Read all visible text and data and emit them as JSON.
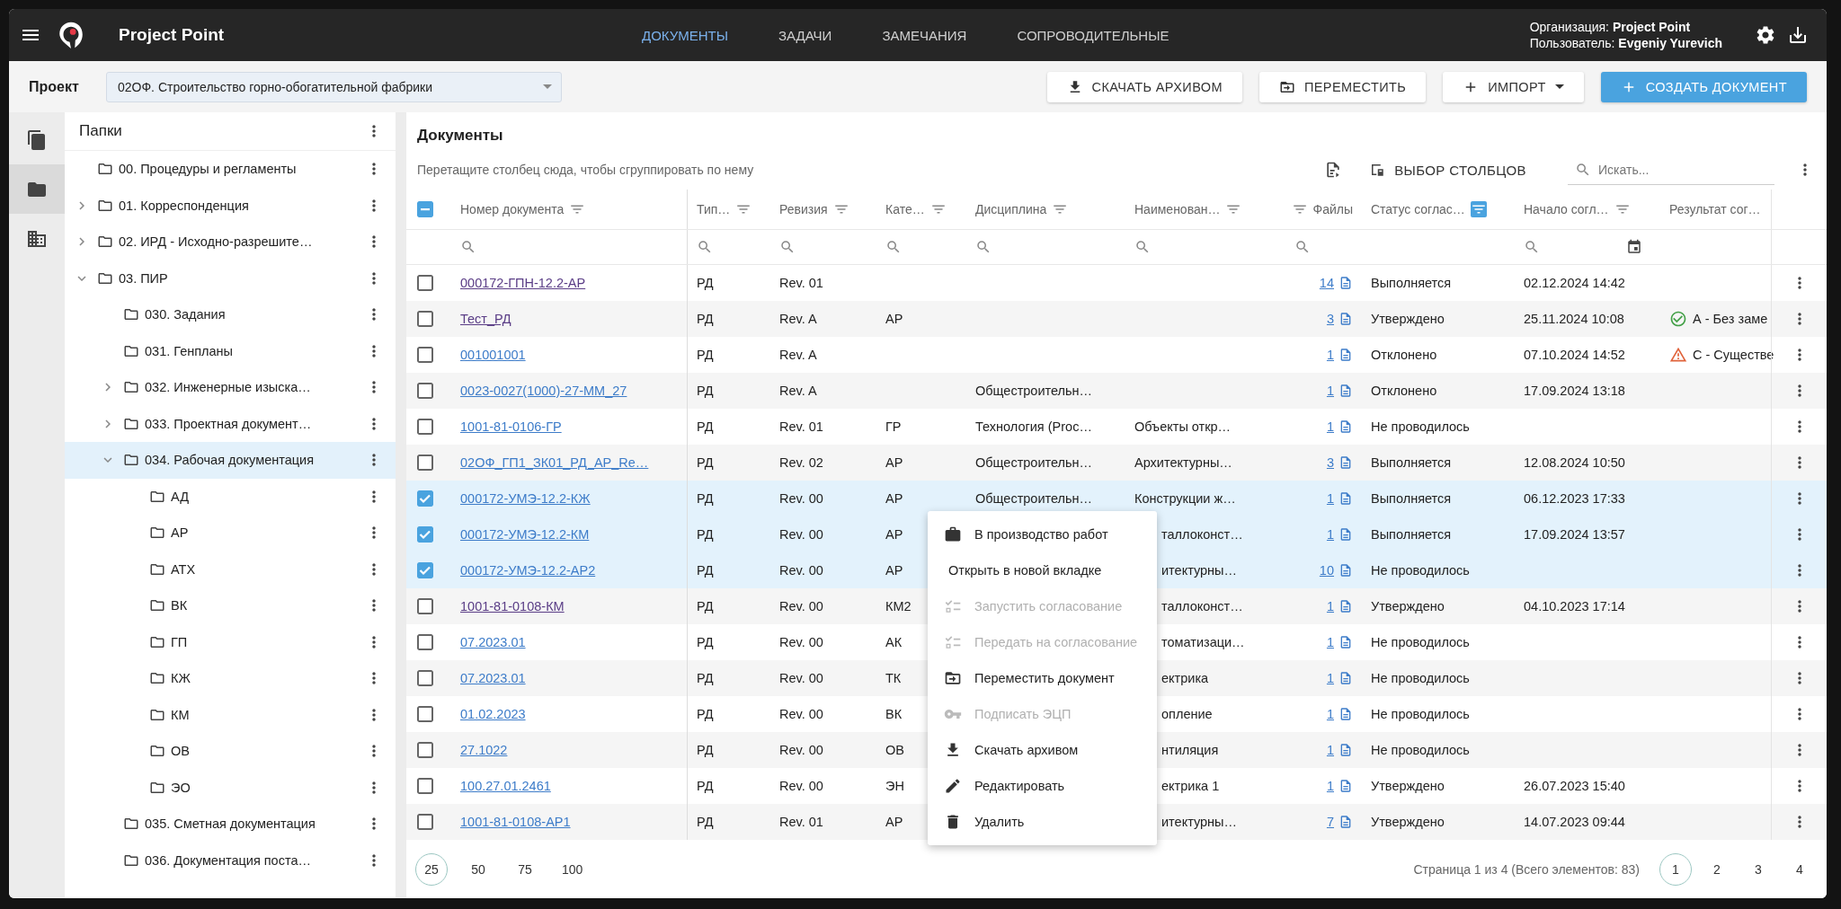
{
  "app": {
    "title": "Project Point"
  },
  "nav": [
    {
      "label": "ДОКУМЕНТЫ",
      "selected": true
    },
    {
      "label": "ЗАДАЧИ",
      "selected": false
    },
    {
      "label": "ЗАМЕЧАНИЯ",
      "selected": false
    },
    {
      "label": "СОПРОВОДИТЕЛЬНЫЕ",
      "selected": false
    }
  ],
  "user": {
    "organization": "Организация: **Project Point**",
    "user": "Пользователь: **Evgeniy Yurevich**"
  },
  "project": {
    "label": "Проект",
    "value": "02ОФ. Строительство горно-обогатительной фабрики"
  },
  "actions": [
    {
      "kind": "download",
      "label": "СКАЧАТЬ АРХИВОМ"
    },
    {
      "kind": "move",
      "label": "ПЕРЕМЕСТИТЬ"
    },
    {
      "kind": "import",
      "label": "ИМПОРТ"
    },
    {
      "kind": "create",
      "label": "СОЗДАТЬ ДОКУМЕНТ"
    }
  ],
  "rail": [
    {
      "kind": "documents",
      "selected": false
    },
    {
      "kind": "folders",
      "selected": true
    },
    {
      "kind": "organizations",
      "selected": false
    }
  ],
  "folders": {
    "title": "Папки",
    "items": [
      {
        "name": "00. Процедуры и регламенты",
        "selected": false
      },
      {
        "name": "01. Корреспонденция",
        "expanded": false,
        "selected": false
      },
      {
        "name": "02. ИРД - Исходно-разрешите…",
        "expanded": false,
        "selected": false
      },
      {
        "name": "03. ПИР",
        "expanded": true,
        "selected": false,
        "children": [
          {
            "name": "030. Задания",
            "selected": false
          },
          {
            "name": "031. Генпланы",
            "selected": false
          },
          {
            "name": "032. Инженерные изыска…",
            "expanded": false,
            "selected": false
          },
          {
            "name": "033. Проектная документ…",
            "expanded": false,
            "selected": false
          },
          {
            "name": "034. Рабочая документация",
            "expanded": true,
            "selected": true,
            "children": [
              {
                "name": "АД",
                "selected": false
              },
              {
                "name": "АР",
                "selected": false
              },
              {
                "name": "АТХ",
                "selected": false
              },
              {
                "name": "ВК",
                "selected": false
              },
              {
                "name": "ГП",
                "selected": false
              },
              {
                "name": "КЖ",
                "selected": false
              },
              {
                "name": "КМ",
                "selected": false
              },
              {
                "name": "ОВ",
                "selected": false
              },
              {
                "name": "ЭО",
                "selected": false
              }
            ]
          },
          {
            "name": "035. Сметная документация",
            "selected": false
          },
          {
            "name": "036. Документация поста…",
            "selected": false
          }
        ]
      }
    ]
  },
  "documents": {
    "title": "Документы",
    "group_hint": "Перетащите столбец сюда, чтобы сгруппировать по нему",
    "column_chooser": "ВЫБОР СТОЛБЦОВ",
    "search": {
      "placeholder": "Искать..."
    },
    "table": {
      "select_all": {
        "checked": false,
        "indeterminate": true
      },
      "columns": [
        {
          "label": "Номер документа",
          "filter_active": false,
          "searchable": true
        },
        {
          "label": "Тип…",
          "filter_active": false,
          "searchable": true
        },
        {
          "label": "Ревизия",
          "filter_active": false,
          "searchable": true
        },
        {
          "label": "Кате…",
          "filter_active": false,
          "searchable": true
        },
        {
          "label": "Дисциплина",
          "filter_active": false,
          "searchable": true
        },
        {
          "label": "Наименован…",
          "filter_active": false,
          "searchable": true
        },
        {
          "label": "Файлы",
          "filter_active": false,
          "searchable": true
        },
        {
          "label": "Статус соглас…",
          "filter_active": true
        },
        {
          "label": "Начало согл…",
          "filter_active": false,
          "searchable": true,
          "date_picker": true
        },
        {
          "label": "Результат сог…"
        }
      ],
      "rows": [
        {
          "number": "000172-ГПН-12.2-АР",
          "visited": true,
          "selected": false,
          "type": "РД",
          "revision": "Rev. 01",
          "files": "14",
          "status": "Выполняется",
          "start": "02.12.2024 14:42"
        },
        {
          "number": "Тест_РД",
          "visited": true,
          "selected": false,
          "type": "РД",
          "revision": "Rev. A",
          "category": "АР",
          "files": "3",
          "status": "Утверждено",
          "start": "25.11.2024 10:08",
          "result": {
            "kind": "approved",
            "text": "А - Без заме"
          }
        },
        {
          "number": "001001001",
          "visited": false,
          "selected": false,
          "type": "РД",
          "revision": "Rev. A",
          "files": "1",
          "status": "Отклонено",
          "start": "07.10.2024 14:52",
          "result": {
            "kind": "warning",
            "text": "С - Существе"
          }
        },
        {
          "number": "0023-0027(1000)-27-ММ_27",
          "visited": false,
          "selected": false,
          "type": "РД",
          "revision": "Rev. A",
          "discipline": "Общестроительн…",
          "files": "1",
          "status": "Отклонено",
          "start": "17.09.2024 13:18"
        },
        {
          "number": "1001-81-0106-ГР",
          "visited": false,
          "selected": false,
          "type": "РД",
          "revision": "Rev. 01",
          "category": "ГР",
          "discipline": "Технология (Proc…",
          "name": "Объекты откр…",
          "files": "1",
          "status": "Не проводилось"
        },
        {
          "number": "02ОФ_ГП1_ЗК01_РД_АР_Re…",
          "visited": false,
          "selected": false,
          "type": "РД",
          "revision": "Rev. 02",
          "category": "АР",
          "discipline": "Общестроительн…",
          "name": "Архитектурны…",
          "files": "3",
          "status": "Выполняется",
          "start": "12.08.2024 10:50"
        },
        {
          "number": "000172-УМЭ-12.2-КЖ",
          "visited": false,
          "selected": true,
          "type": "РД",
          "revision": "Rev. 00",
          "category": "АР",
          "discipline": "Общестроительн…",
          "name": "Конструкции ж…",
          "files": "1",
          "status": "Выполняется",
          "start": "06.12.2023 17:33"
        },
        {
          "number": "000172-УМЭ-12.2-КМ",
          "visited": false,
          "selected": true,
          "type": "РД",
          "revision": "Rev. 00",
          "category": "АР",
          "name": "таллоконст…",
          "files": "1",
          "status": "Выполняется",
          "start": "17.09.2024 13:57"
        },
        {
          "number": "000172-УМЭ-12.2-АР2",
          "visited": false,
          "selected": true,
          "type": "РД",
          "revision": "Rev. 00",
          "category": "АР",
          "name": "итектурны…",
          "files": "10",
          "status": "Не проводилось"
        },
        {
          "number": "1001-81-0108-КМ",
          "visited": true,
          "selected": false,
          "type": "РД",
          "revision": "Rev. 00",
          "category": "КМ2",
          "name": "таллоконст…",
          "files": "1",
          "status": "Утверждено",
          "start": "04.10.2023 17:14"
        },
        {
          "number": "07.2023.01",
          "visited": false,
          "selected": false,
          "type": "РД",
          "revision": "Rev. 00",
          "category": "АК",
          "name": "томатизаци…",
          "files": "1",
          "status": "Не проводилось"
        },
        {
          "number": "07.2023.01",
          "visited": false,
          "selected": false,
          "type": "РД",
          "revision": "Rev. 00",
          "category": "ТК",
          "name": "ектрика",
          "files": "1",
          "status": "Не проводилось"
        },
        {
          "number": "01.02.2023",
          "visited": false,
          "selected": false,
          "type": "РД",
          "revision": "Rev. 00",
          "category": "ВК",
          "name": "опление",
          "files": "1",
          "status": "Не проводилось"
        },
        {
          "number": "27.1022",
          "visited": false,
          "selected": false,
          "type": "РД",
          "revision": "Rev. 00",
          "category": "ОВ",
          "name": "нтиляция",
          "files": "1",
          "status": "Не проводилось"
        },
        {
          "number": "100.27.01.2461",
          "visited": false,
          "selected": false,
          "type": "РД",
          "revision": "Rev. 00",
          "category": "ЭН",
          "name": "ектрика 1",
          "files": "1",
          "status": "Утверждено",
          "start": "26.07.2023 15:40"
        },
        {
          "number": "1001-81-0108-АР1",
          "visited": false,
          "selected": false,
          "type": "РД",
          "revision": "Rev. 01",
          "category": "АР",
          "name": "итектурны…",
          "files": "7",
          "status": "Утверждено",
          "start": "14.07.2023 09:44"
        }
      ]
    },
    "context_menu": [
      {
        "kind": "production",
        "label": "В производство работ",
        "disabled": false
      },
      {
        "kind": "open",
        "label": "Открыть в новой вкладке",
        "disabled": false
      },
      {
        "kind": "approval",
        "label": "Запустить согласование",
        "disabled": true
      },
      {
        "kind": "approval",
        "label": "Передать на согласование",
        "disabled": true
      },
      {
        "kind": "move",
        "label": "Переместить документ",
        "disabled": false
      },
      {
        "kind": "sign",
        "label": "Подписать ЭЦП",
        "disabled": true
      },
      {
        "kind": "download",
        "label": "Скачать архивом",
        "disabled": false
      },
      {
        "kind": "edit",
        "label": "Редактировать",
        "disabled": false
      },
      {
        "kind": "delete",
        "label": "Удалить",
        "disabled": false
      }
    ],
    "pagination": {
      "page_sizes": [
        {
          "label": "25",
          "selected": true
        },
        {
          "label": "50",
          "selected": false
        },
        {
          "label": "75",
          "selected": false
        },
        {
          "label": "100",
          "selected": false
        }
      ],
      "summary": "Страница 1 из 4 (Всего элементов: 83)",
      "pages": [
        {
          "label": "1",
          "selected": true
        },
        {
          "label": "2",
          "selected": false
        },
        {
          "label": "3",
          "selected": false
        },
        {
          "label": "4",
          "selected": false
        }
      ]
    }
  }
}
